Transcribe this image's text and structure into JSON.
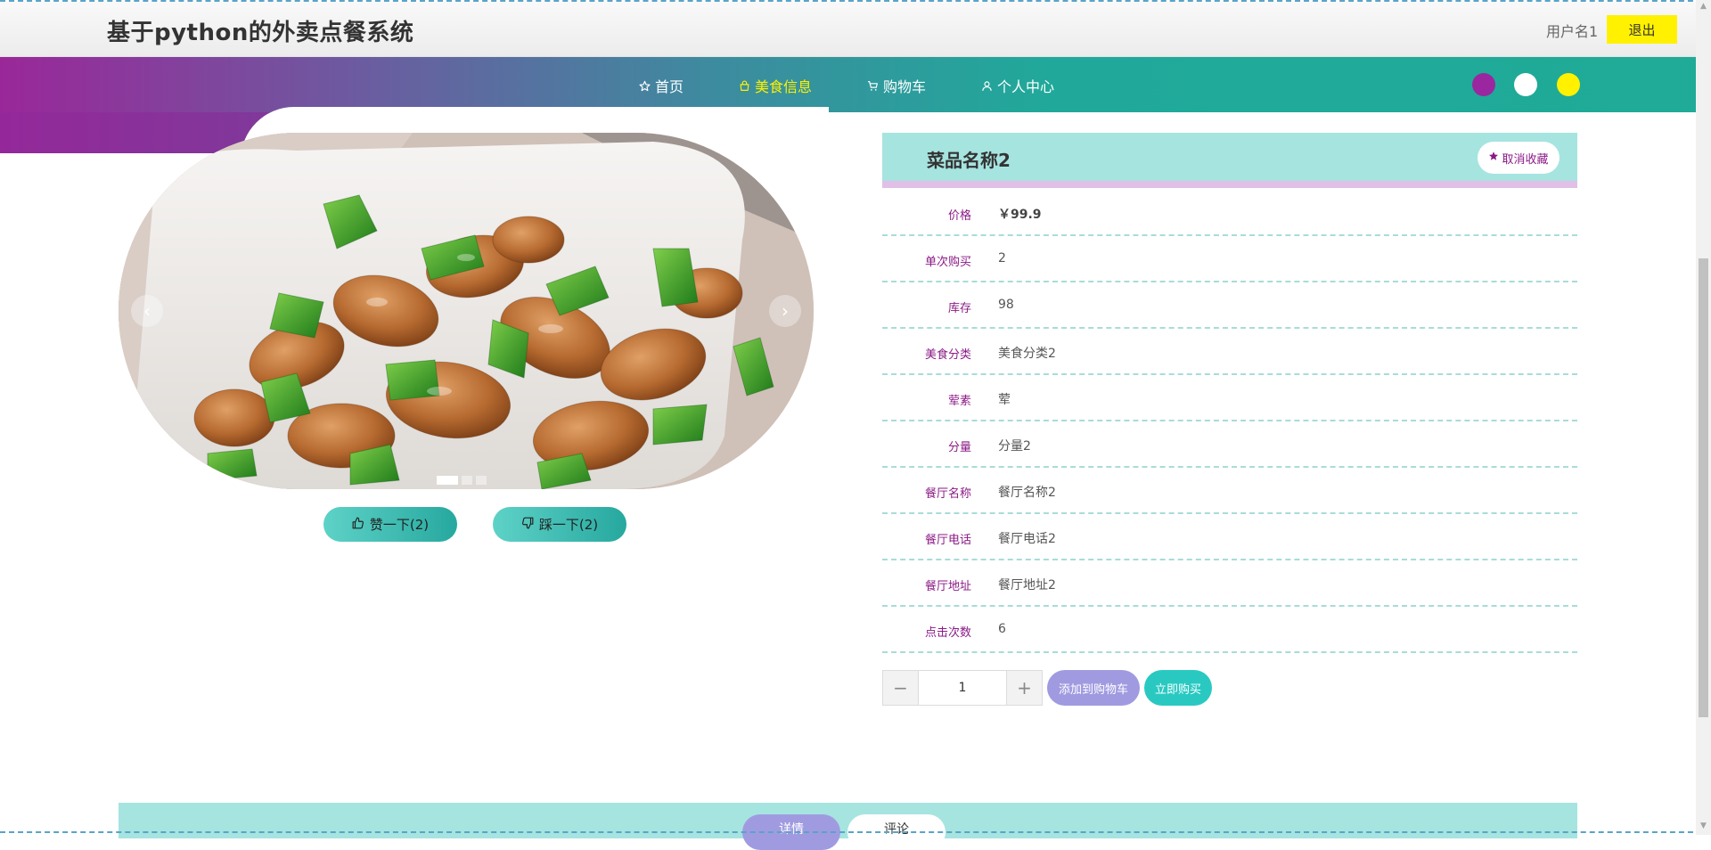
{
  "header": {
    "site_title": "基于python的外卖点餐系统",
    "username": "用户名1",
    "logout_label": "退出",
    "logout_color": "#fff100"
  },
  "nav": {
    "items": [
      {
        "label": "首页",
        "icon": "star-icon",
        "active": false
      },
      {
        "label": "美食信息",
        "icon": "bag-icon",
        "active": true
      },
      {
        "label": "购物车",
        "icon": "cart-icon",
        "active": false
      },
      {
        "label": "个人中心",
        "icon": "user-icon",
        "active": false
      }
    ],
    "active_color": "#fff100",
    "theme_colors": [
      "#9b27a0",
      "#ffffff",
      "#fff100"
    ]
  },
  "carousel": {
    "slide_count": 3,
    "active_slide": 1,
    "prev_icon": "chevron-left-icon",
    "next_icon": "chevron-right-icon",
    "image": "青椒炒肉"
  },
  "votes": {
    "like_label": "赞一下(2)",
    "dislike_label": "踩一下(2)"
  },
  "detail": {
    "name": "菜品名称2",
    "fav_label": "取消收藏",
    "rows": [
      {
        "label": "价格",
        "value": "￥99.9"
      },
      {
        "label": "单次购买",
        "value": "2"
      },
      {
        "label": "库存",
        "value": "98"
      },
      {
        "label": "美食分类",
        "value": "美食分类2"
      },
      {
        "label": "荤素",
        "value": "荤"
      },
      {
        "label": "分量",
        "value": "分量2"
      },
      {
        "label": "餐厅名称",
        "value": "餐厅名称2"
      },
      {
        "label": "餐厅电话",
        "value": "餐厅电话2"
      },
      {
        "label": "餐厅地址",
        "value": "餐厅地址2"
      },
      {
        "label": "点击次数",
        "value": "6"
      }
    ]
  },
  "order": {
    "minus": "−",
    "plus": "+",
    "quantity": "1",
    "add_to_cart_label": "添加到购物车",
    "buy_now_label": "立即购买"
  },
  "tabs": {
    "detail_label": "详情",
    "comment_label": "评论"
  }
}
